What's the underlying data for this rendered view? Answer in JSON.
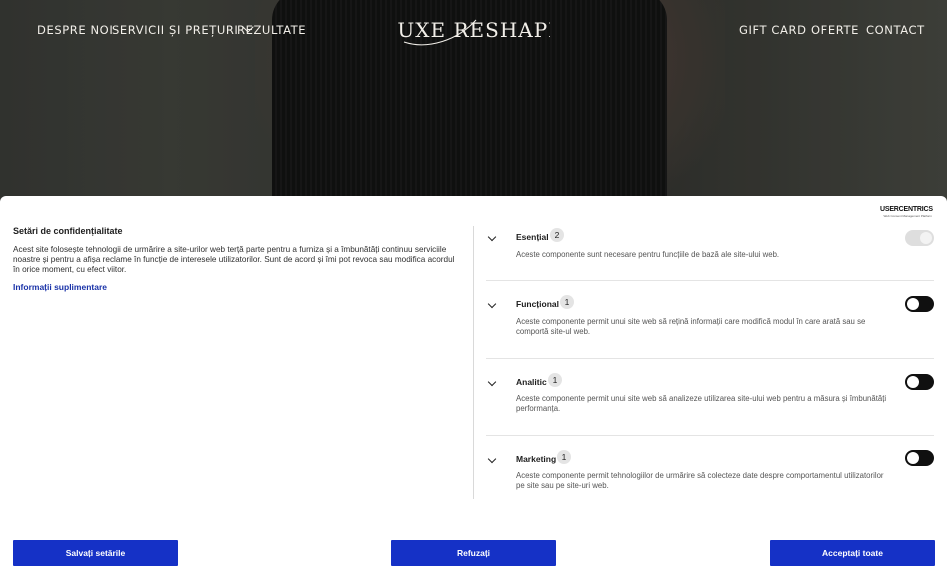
{
  "nav": {
    "left": [
      "DESPRE NOI",
      "SERVICII ȘI PREȚURI",
      "REZULTATE"
    ],
    "right": [
      "GIFT CARD",
      "OFERTE",
      "CONTACT"
    ],
    "logo_text": "LUXE RESHAPE"
  },
  "consent": {
    "brand": "USERCENTRICS",
    "brand_sub": "Web Consent Management Platform",
    "title": "Setări de confidențialitate",
    "description": "Acest site folosește tehnologii de urmărire a site-urilor web terță parte pentru a furniza și a îmbunătăți continuu serviciile noastre și pentru a afișa reclame în funcție de interesele utilizatorilor. Sunt de acord și îmi pot revoca sau modifica acordul în orice moment, cu efect viitor.",
    "more_link": "Informații suplimentare",
    "categories": [
      {
        "title": "Esențial",
        "count": "2",
        "description": "Aceste componente sunt necesare pentru funcțiile de bază ale site-ului web.",
        "enabled": true,
        "locked": true
      },
      {
        "title": "Funcțional",
        "count": "1",
        "description": "Aceste componente permit unui site web să rețină informații care modifică modul în care arată sau se comportă site-ul web.",
        "enabled": false,
        "locked": false
      },
      {
        "title": "Analitic",
        "count": "1",
        "description": "Aceste componente permit unui site web să analizeze utilizarea site-ului web pentru a măsura și îmbunătăți performanța.",
        "enabled": false,
        "locked": false
      },
      {
        "title": "Marketing",
        "count": "1",
        "description": "Aceste componente permit tehnologiilor de urmărire să colecteze date despre comportamentul utilizatorilor pe site sau pe site-uri web.",
        "enabled": false,
        "locked": false
      }
    ],
    "buttons": {
      "save": "Salvați setările",
      "refuse": "Refuzați",
      "accept": "Acceptați toate"
    },
    "accent_color": "#1531c6"
  }
}
